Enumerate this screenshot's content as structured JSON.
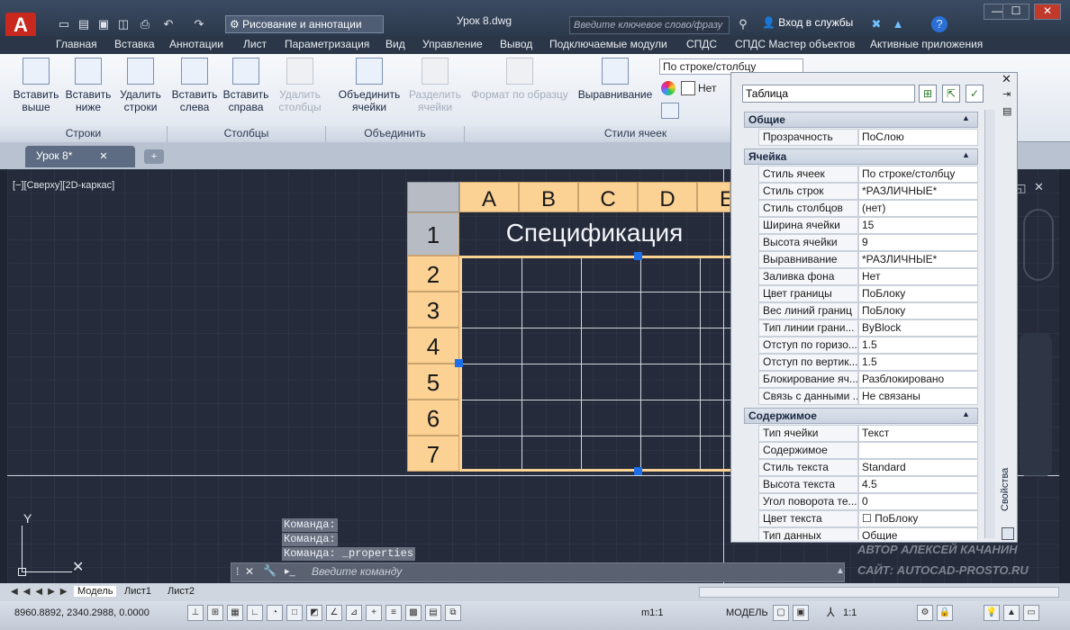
{
  "titlebar": {
    "app_button": "A",
    "workspace": "Рисование и аннотации",
    "doc_title": "Урок 8.dwg",
    "search_placeholder": "Введите ключевое слово/фразу",
    "login": "Вход в службы"
  },
  "ribbon_tabs": [
    "Главная",
    "Вставка",
    "Аннотации",
    "Лист",
    "Параметризация",
    "Вид",
    "Управление",
    "Вывод",
    "Подключаемые модули",
    "СПДС",
    "СПДС Мастер объектов",
    "Активные приложения"
  ],
  "ribbon": {
    "rows": {
      "b1": "Вставить\nвыше",
      "b2": "Вставить\nниже",
      "b3": "Удалить\nстроки",
      "label": "Строки"
    },
    "cols": {
      "b1": "Вставить\nслева",
      "b2": "Вставить\nсправа",
      "b3": "Удалить\nстолбцы",
      "label": "Столбцы"
    },
    "merge": {
      "b1": "Объединить\nячейки",
      "b2": "Разделить\nячейки",
      "label": "Объединить"
    },
    "styles": {
      "b1": "Формат по образцу",
      "b2": "Выравнивание",
      "label": "Стили ячеек",
      "select": "По строке/столбцу",
      "fill": "Нет"
    }
  },
  "doc_tab": "Урок 8*",
  "viewport_label": "[−][Сверху][2D-каркас]",
  "table": {
    "col_headers": [
      "A",
      "B",
      "C",
      "D",
      "E"
    ],
    "row_headers": [
      "1",
      "2",
      "3",
      "4",
      "5",
      "6",
      "7"
    ],
    "title": "Спецификация"
  },
  "properties": {
    "type": "Таблица",
    "sections": [
      {
        "name": "Общие",
        "rows": [
          [
            "Прозрачность",
            "ПоСлою"
          ]
        ]
      },
      {
        "name": "Ячейка",
        "rows": [
          [
            "Стиль ячеек",
            "По строке/столбцу"
          ],
          [
            "Стиль строк",
            "*РАЗЛИЧНЫЕ*"
          ],
          [
            "Стиль столбцов",
            "(нет)"
          ],
          [
            "Ширина ячейки",
            "15"
          ],
          [
            "Высота ячейки",
            "9"
          ],
          [
            "Выравнивание",
            "*РАЗЛИЧНЫЕ*"
          ],
          [
            "Заливка фона",
            "Нет"
          ],
          [
            "Цвет границы",
            "ПоБлоку"
          ],
          [
            "Вес линий границ",
            "ПоБлоку"
          ],
          [
            "Тип линии грани...",
            "ByBlock"
          ],
          [
            "Отступ по горизо...",
            "1.5"
          ],
          [
            "Отступ по вертик...",
            "1.5"
          ],
          [
            "Блокирование яч...",
            "Разблокировано"
          ],
          [
            "Связь с данными ...",
            "Не связаны"
          ]
        ]
      },
      {
        "name": "Содержимое",
        "rows": [
          [
            "Тип ячейки",
            "Текст"
          ],
          [
            "Содержимое",
            ""
          ],
          [
            "Стиль текста",
            "Standard"
          ],
          [
            "Высота текста",
            "4.5"
          ],
          [
            "Угол поворота те...",
            "0"
          ],
          [
            "Цвет текста",
            "☐ ПоБлоку"
          ],
          [
            "Тип данных",
            "Общие"
          ]
        ]
      }
    ],
    "vertical_title": "Свойства"
  },
  "command": {
    "history": [
      "Команда:",
      "Команда:",
      "Команда: _properties"
    ],
    "placeholder": "Введите команду"
  },
  "watermark": [
    "АВТОР АЛЕКСЕЙ КАЧАНИН",
    "САЙТ: AUTOCAD-PROSTO.RU"
  ],
  "layout_tabs": [
    "Модель",
    "Лист1",
    "Лист2"
  ],
  "status": {
    "coords": "8960.8892, 2340.2988, 0.0000",
    "scale": "m1:1",
    "model": "МОДЕЛЬ",
    "ratio": "1:1"
  }
}
